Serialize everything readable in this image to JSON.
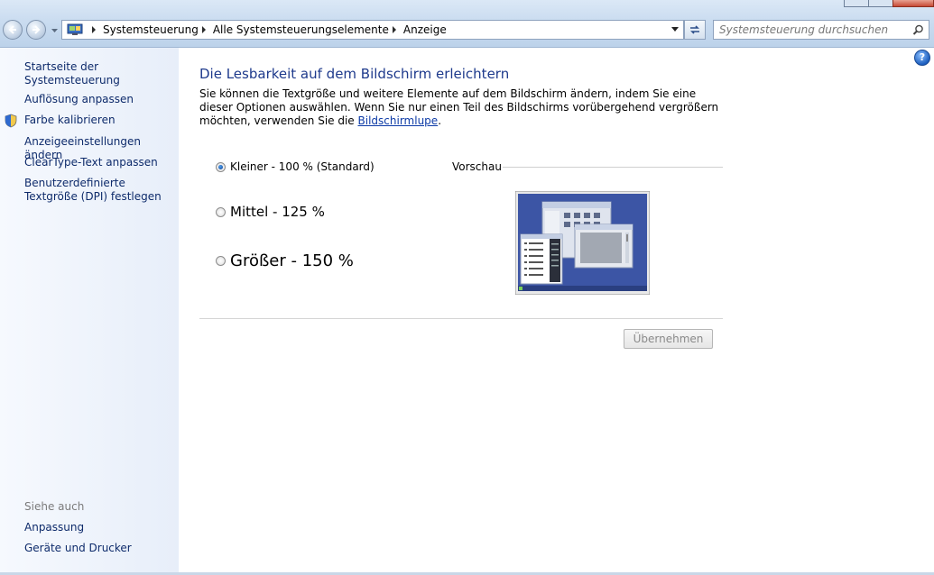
{
  "address_bar": {
    "crumbs": [
      "Systemsteuerung",
      "Alle Systemsteuerungselemente",
      "Anzeige"
    ]
  },
  "search": {
    "placeholder": "Systemsteuerung durchsuchen"
  },
  "sidebar": {
    "home_link": "Startseite der Systemsteuerung",
    "links": [
      "Auflösung anpassen",
      "Farbe kalibrieren",
      "Anzeigeeinstellungen ändern",
      "ClearType-Text anpassen",
      "Benutzerdefinierte Textgröße (DPI) festlegen"
    ],
    "see_also_heading": "Siehe auch",
    "see_also_links": [
      "Anpassung",
      "Geräte und Drucker"
    ]
  },
  "main": {
    "help_glyph": "?",
    "title": "Die Lesbarkeit auf dem Bildschirm erleichtern",
    "description": "Sie können die Textgröße und weitere Elemente auf dem Bildschirm ändern, indem Sie eine dieser Optionen auswählen. Wenn Sie nur einen Teil des Bildschirms vorübergehend vergrößern möchten, verwenden Sie die",
    "magnifier_link": "Bildschirmlupe",
    "description_end": ".",
    "options": [
      {
        "label": "Kleiner - 100 % (Standard)",
        "checked": true
      },
      {
        "label": "Mittel - 125 %",
        "checked": false
      },
      {
        "label": "Größer - 150 %",
        "checked": false
      }
    ],
    "preview_label": "Vorschau",
    "apply_button": "Übernehmen"
  },
  "colors": {
    "link": "#0e2b6b",
    "title": "#1e3a8c",
    "sidebar_bg": "#e7eef9",
    "preview_bg": "#3c55a5"
  }
}
